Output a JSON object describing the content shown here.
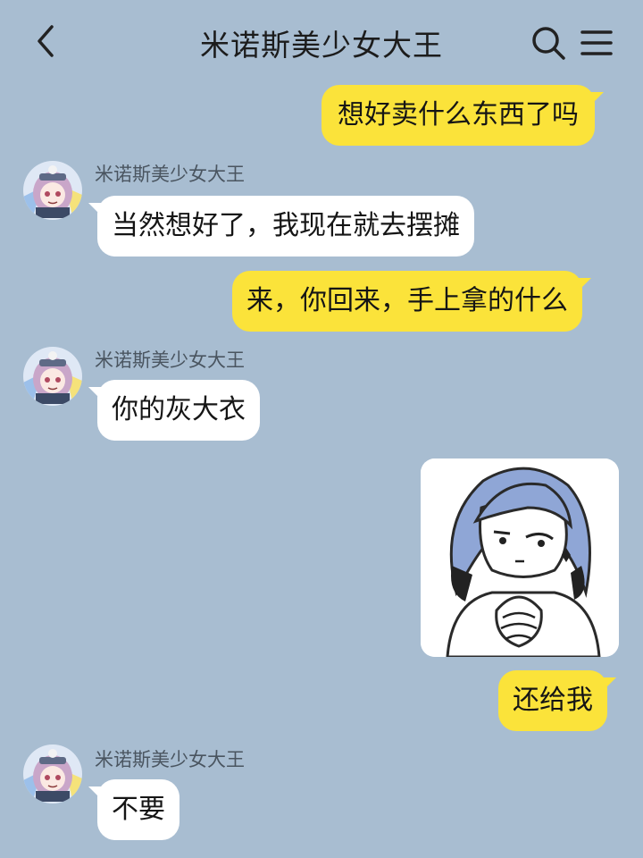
{
  "header": {
    "title": "米诺斯美少女大王",
    "back_icon": "chevron-left-icon",
    "search_icon": "search-icon",
    "menu_icon": "menu-icon"
  },
  "messages": [
    {
      "side": "right",
      "text": "想好卖什么东西了吗"
    },
    {
      "side": "left",
      "sender": "米诺斯美少女大王",
      "text": "当然想好了，我现在就去摆摊"
    },
    {
      "side": "right",
      "text": "来，你回来，手上拿的什么"
    },
    {
      "side": "left",
      "sender": "米诺斯美少女大王",
      "text": "你的灰大衣"
    },
    {
      "side": "right",
      "type": "sticker",
      "sticker": "anime-girl-clasped-hands-sticker"
    },
    {
      "side": "right",
      "text": "还给我"
    },
    {
      "side": "left",
      "sender": "米诺斯美少女大王",
      "text": "不要"
    }
  ],
  "colors": {
    "background": "#a8bdd1",
    "self_bubble": "#fbe33a",
    "other_bubble": "#ffffff"
  }
}
